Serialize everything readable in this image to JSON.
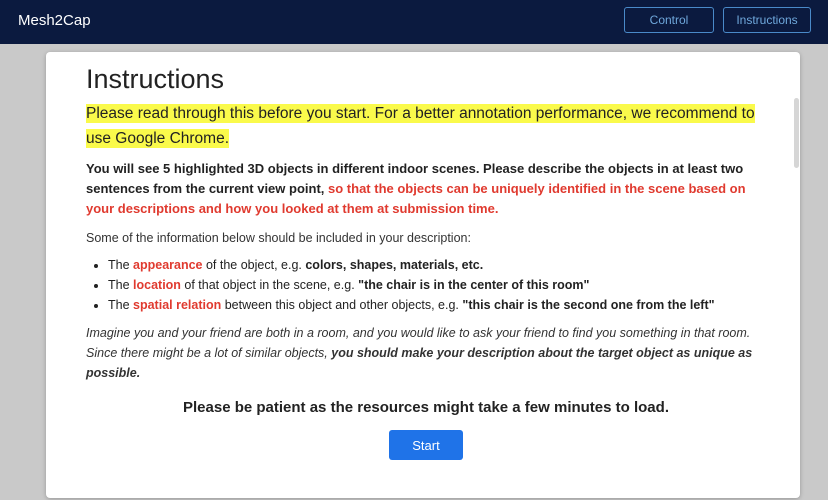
{
  "navbar": {
    "brand": "Mesh2Cap",
    "control_label": "Control",
    "instructions_label": "Instructions"
  },
  "modal": {
    "title": "Instructions",
    "highlight_text": "Please read through this before you start. For a better annotation performance, we recommend to use Google Chrome.",
    "intro_text": "You will see 5 highlighted 3D objects in different indoor scenes. Please describe the objects in at least two sentences from the current view point,",
    "intro_red": "so that the objects can be uniquely identified in the scene based on your descriptions and how you looked at them at submission time.",
    "lead_text": "Some of the information below should be included in your description:",
    "points": [
      {
        "pre": "The ",
        "key": "appearance",
        "mid": " of the object, e.g. ",
        "example": "colors, shapes, materials, etc."
      },
      {
        "pre": "The ",
        "key": "location",
        "mid": " of that object in the scene, e.g. ",
        "example": "\"the chair is in the center of this room\""
      },
      {
        "pre": "The ",
        "key": "spatial relation",
        "mid": " between this object and other objects, e.g. ",
        "example": "\"this chair is the second one from the left\""
      }
    ],
    "imagine_text": "Imagine you and your friend are both in a room, and you would like to ask your friend to find you something in that room. Since there might be a lot of similar objects,",
    "imagine_bold": "you should make your description about the target object as unique as possible.",
    "patience_text": "Please be patient as the resources might take a few minutes to load.",
    "start_label": "Start"
  },
  "colors": {
    "navbar_bg": "#0b1a3f",
    "highlight": "#fafa4b",
    "accent_red": "#e03a2f",
    "start_button": "#1f73e8"
  }
}
